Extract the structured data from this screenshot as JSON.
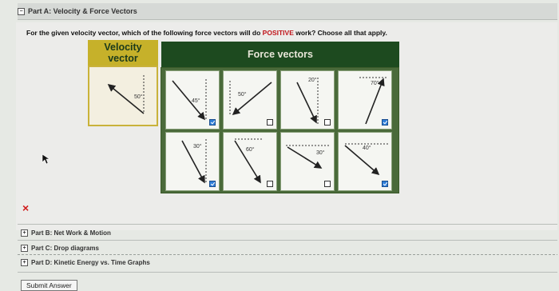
{
  "header": {
    "toggle": "−",
    "title": "Part A: Velocity & Force Vectors"
  },
  "question": {
    "before": "For the given velocity vector, which of the following force vectors will do ",
    "highlight": "POSITIVE",
    "after": " work? Choose all that apply."
  },
  "table": {
    "velocity_header_line1": "Velocity",
    "velocity_header_line2": "vector",
    "force_header": "Force vectors",
    "velocity_angle": "50°",
    "force_cells": [
      {
        "angle": "45°",
        "checked": true
      },
      {
        "angle": "50°",
        "checked": false
      },
      {
        "angle": "20°",
        "checked": false
      },
      {
        "angle": "70°",
        "checked": true
      },
      {
        "angle": "30°",
        "checked": true
      },
      {
        "angle": "60°",
        "checked": false
      },
      {
        "angle": "30°",
        "checked": false
      },
      {
        "angle": "40°",
        "checked": true
      }
    ]
  },
  "result_mark": "×",
  "parts": [
    {
      "toggle": "+",
      "label": "Part B: Net Work & Motion"
    },
    {
      "toggle": "+",
      "label": "Part C: Drop diagrams"
    },
    {
      "toggle": "+",
      "label": "Part D: Kinetic Energy vs. Time Graphs"
    }
  ],
  "submit_label": "Submit Answer",
  "colors": {
    "velocity_header": "#c6b12a",
    "force_header": "#1d4a1f",
    "checkbox_checked": "#2f7ed8",
    "error": "#d01a1a"
  }
}
